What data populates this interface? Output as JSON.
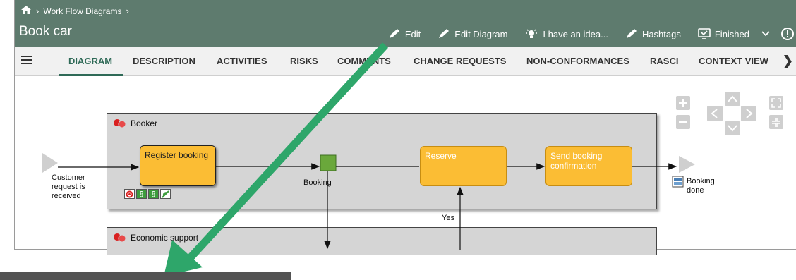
{
  "breadcrumb": {
    "home_icon": "home-icon",
    "item": "Work Flow Diagrams"
  },
  "page_title": "Book car",
  "actions": [
    {
      "label": "Edit",
      "icon": "pencil-icon"
    },
    {
      "label": "Edit Diagram",
      "icon": "pencil-icon"
    },
    {
      "label": "I have an idea...",
      "icon": "lightbulb-icon"
    },
    {
      "label": "Hashtags",
      "icon": "pencil-icon"
    },
    {
      "label": "Finished",
      "icon": "monitor-check-icon"
    }
  ],
  "tabs": [
    "DIAGRAM",
    "DESCRIPTION",
    "ACTIVITIES",
    "RISKS",
    "COMMENTS",
    "CHANGE REQUESTS",
    "NON-CONFORMANCES",
    "RASCI",
    "CONTEXT VIEW"
  ],
  "active_tab": "DIAGRAM",
  "diagram": {
    "lanes": [
      {
        "name": "Booker"
      },
      {
        "name": "Economic support"
      }
    ],
    "start_event": "Customer request is received",
    "tasks": [
      "Register booking",
      "Reserve",
      "Send booking confirmation"
    ],
    "data_object": "Booking",
    "end_event": "Booking done",
    "flow_label_yes": "Yes",
    "task_badges": [
      "target",
      "§",
      "§",
      "leaf"
    ]
  },
  "colors": {
    "header": "#5e7b6e",
    "accent": "#2f6a57",
    "task": "#fbbd34",
    "arrow": "#2ea66a"
  }
}
